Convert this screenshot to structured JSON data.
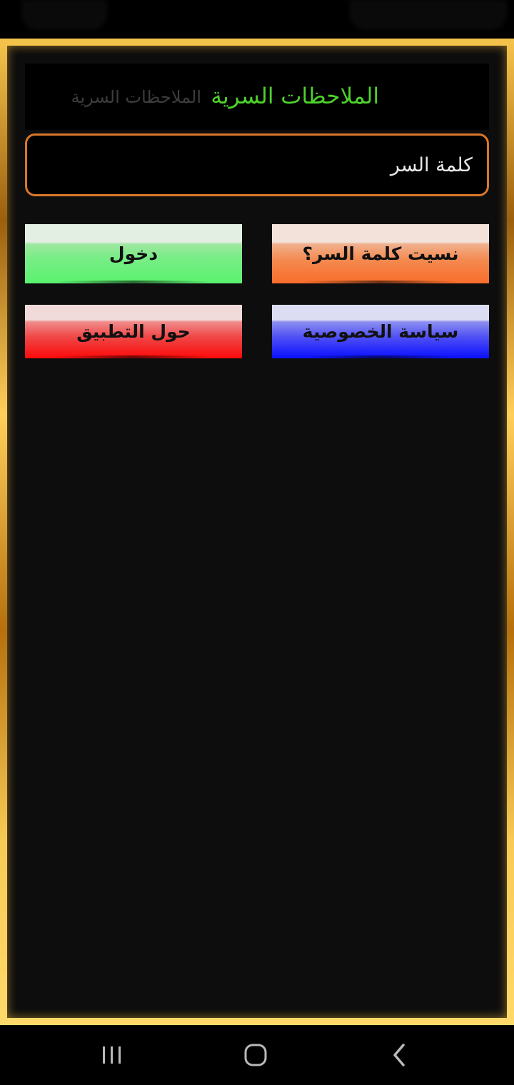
{
  "app": {
    "title": "الملاحظات السرية",
    "title_shadow": "الملاحظات السرية"
  },
  "password": {
    "placeholder": "كلمة السر",
    "value": ""
  },
  "buttons": {
    "login_label": "دخول",
    "forgot_label": "نسيت كلمة السر؟",
    "about_label": "حول التطبيق",
    "privacy_label": "سياسة الخصوصية"
  },
  "colors": {
    "title": "#4dd22c",
    "field_border": "#d9772a",
    "frame": "#f3c24a",
    "login": "#5af26f",
    "forgot": "#f86d2b",
    "about": "#fc0a0a",
    "privacy": "#0a10ff"
  },
  "navigation": {
    "recents_icon": "recents-icon",
    "home_icon": "home-icon",
    "back_icon": "back-icon"
  }
}
